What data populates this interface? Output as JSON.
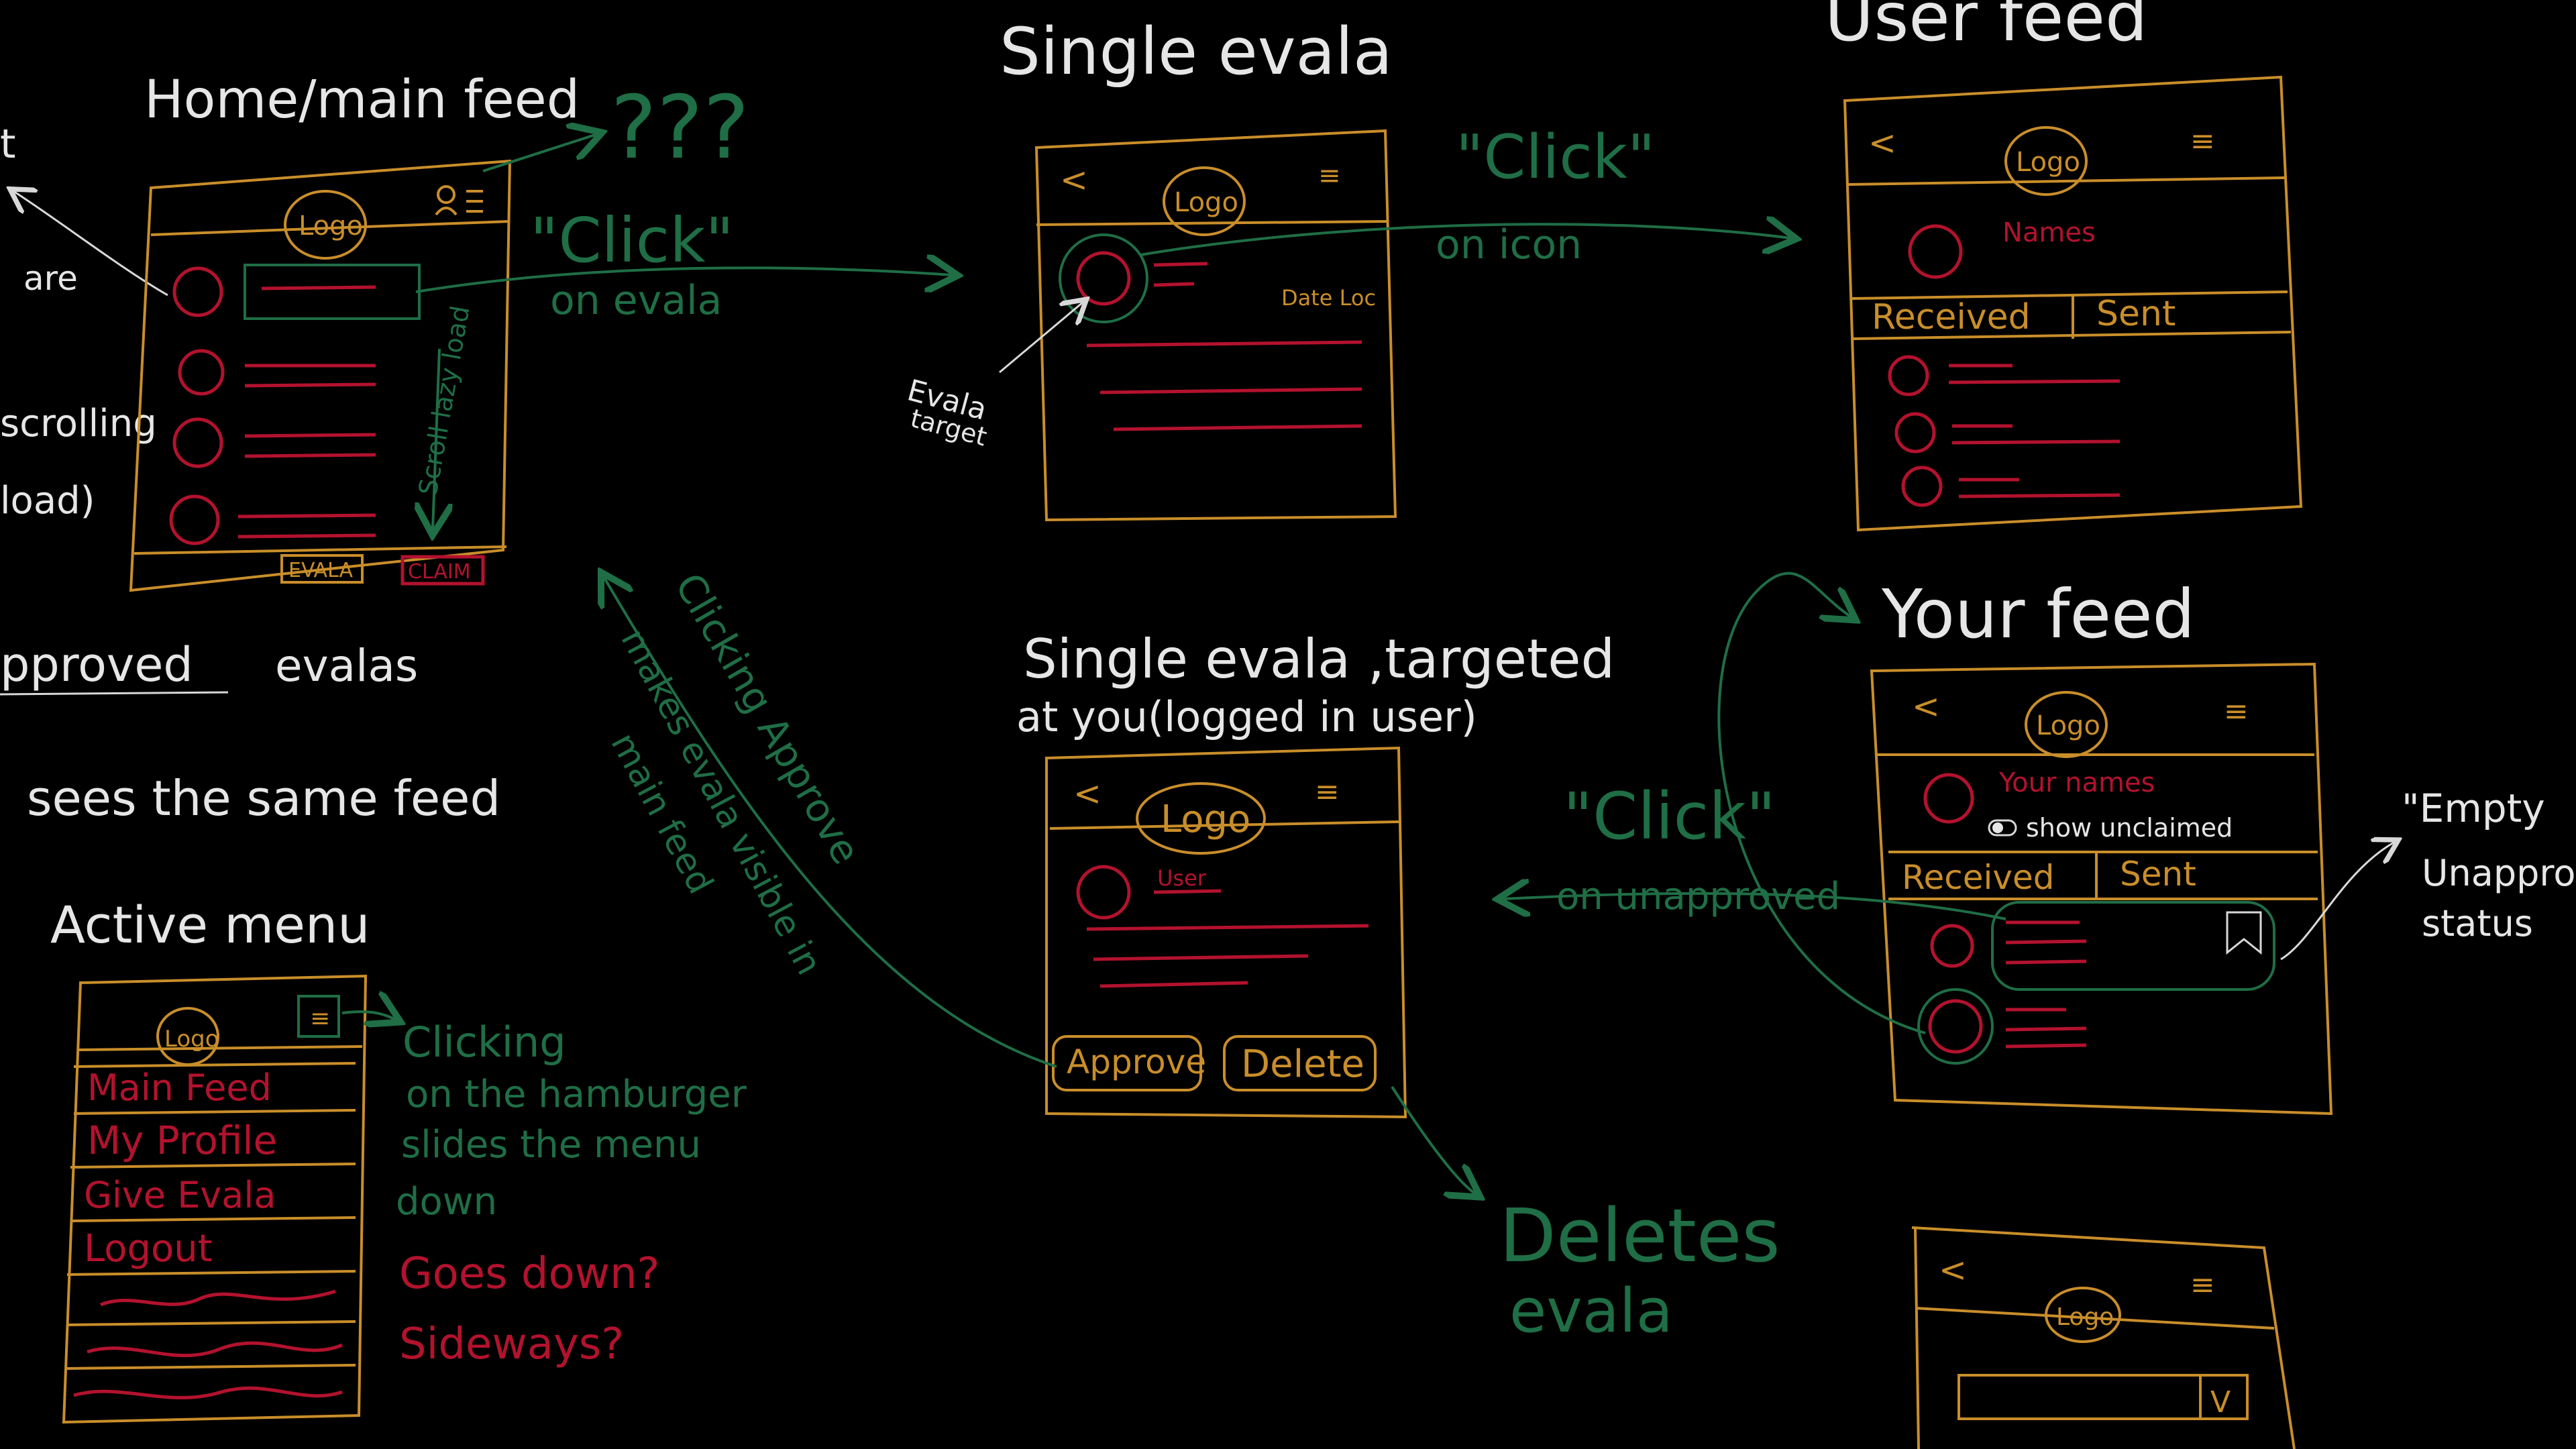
{
  "colors": {
    "board": "#000000",
    "chalk_white": "#e6e6e6",
    "chalk_green": "#1f6e46",
    "chalk_red": "#b3122e",
    "chalk_orange": "#c98e2a"
  },
  "headings": {
    "home_feed": "Home/main feed",
    "single_evala": "Single evala",
    "user_feed": "User feed",
    "your_feed": "Your feed",
    "single_targeted_line1": "Single evala ,targeted",
    "single_targeted_line2": "at you(logged in user)",
    "active_menu": "Active menu"
  },
  "left_notes": {
    "note_t": "t",
    "note_are": "are",
    "note_scrolling": "scrolling",
    "note_load": "load)",
    "approved_word": "pproved",
    "evalas_word": "evalas",
    "sees_same": "sees the same feed"
  },
  "home_wireframe": {
    "logo": "Logo",
    "question_marks": "???",
    "scroll_note": "Scroll lazy load",
    "evala_button": "EVALA",
    "claim_button": "CLAIM"
  },
  "single_wireframe": {
    "back": "<",
    "logo": "Logo",
    "menu": "≡",
    "date": "Date Loc",
    "target_note_1": "Evala",
    "target_note_2": "target"
  },
  "user_feed_wireframe": {
    "back": "<",
    "logo": "Logo",
    "menu": "≡",
    "names": "Names",
    "tab_received": "Received",
    "tab_sent": "Sent"
  },
  "your_feed_wireframe": {
    "back": "<",
    "logo": "Logo",
    "menu": "≡",
    "your_names": "Your names",
    "toggle_label": "show unclaimed",
    "tab_received": "Received",
    "tab_sent": "Sent"
  },
  "targeted_wireframe": {
    "back": "<",
    "logo": "Logo",
    "menu": "≡",
    "user": "User",
    "approve_button": "Approve",
    "delete_button": "Delete"
  },
  "menu_wireframe": {
    "logo": "Logo",
    "menu": "≡",
    "items": [
      "Main Feed",
      "My Profile",
      "Give Evala",
      "Logout"
    ]
  },
  "bottom_wireframe": {
    "back": "<",
    "logo": "Logo",
    "menu": "≡",
    "dropdown_caret": "V"
  },
  "annotations": {
    "click_evala_1": "\"Click\"",
    "click_evala_2": "on evala",
    "click_icon_1": "\"Click\"",
    "click_icon_2": "on icon",
    "click_unapproved_1": "\"Click\"",
    "click_unapproved_2": "on unapproved",
    "clicking_approve_1": "Clicking Approve",
    "clicking_approve_2": "makes evala visible in",
    "clicking_approve_3": "main feed",
    "hamburger_1": "Clicking",
    "hamburger_2": "on the hamburger",
    "hamburger_3": "slides the menu",
    "hamburger_4": "down",
    "goes_down_1": "Goes down?",
    "goes_down_2": "Sideways?",
    "deletes_1": "Deletes",
    "deletes_2": "evala",
    "empty_1": "\"Empty",
    "empty_2": "Unapprov",
    "empty_3": "status"
  }
}
